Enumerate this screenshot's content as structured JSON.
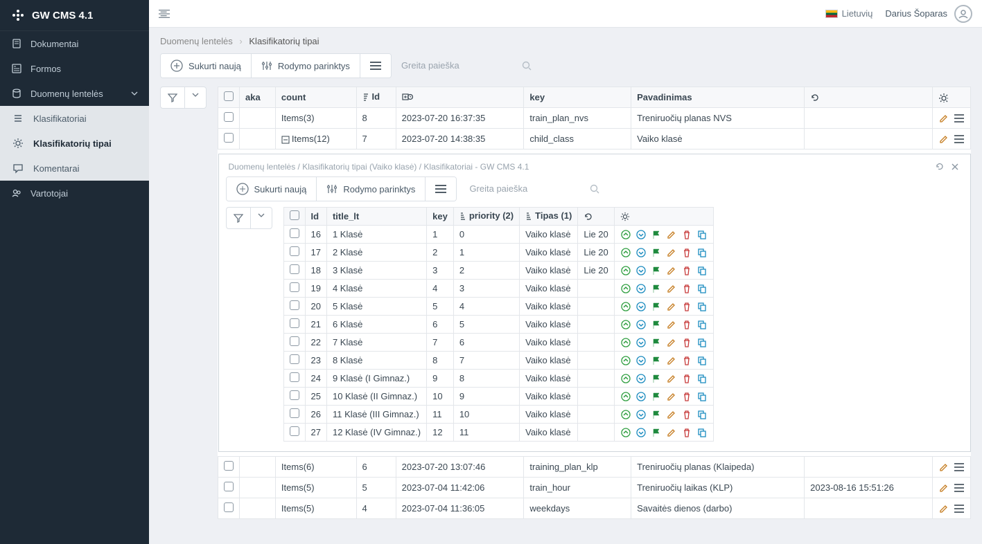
{
  "brand": "GW CMS 4.1",
  "topbar": {
    "language": "Lietuvių",
    "user": "Darius Šoparas"
  },
  "nav": {
    "items": [
      {
        "label": "Dokumentai",
        "icon": "doc"
      },
      {
        "label": "Formos",
        "icon": "form"
      },
      {
        "label": "Duomenų lentelės",
        "icon": "db",
        "expandable": true,
        "expanded": true,
        "children": [
          {
            "label": "Klasifikatoriai",
            "icon": "list"
          },
          {
            "label": "Klasifikatorių tipai",
            "icon": "gear",
            "active": true
          },
          {
            "label": "Komentarai",
            "icon": "chat"
          }
        ]
      },
      {
        "label": "Vartotojai",
        "icon": "users"
      }
    ]
  },
  "breadcrumb": {
    "parent": "Duomenų lentelės",
    "current": "Klasifikatorių tipai"
  },
  "toolbar": {
    "create": "Sukurti naują",
    "display": "Rodymo parinktys",
    "search_ph": "Greita paieška"
  },
  "grid": {
    "headers": {
      "aka": "aka",
      "count": "count",
      "id": "Id",
      "created": "",
      "key": "key",
      "name": "Pavadinimas",
      "updated": ""
    },
    "rows": [
      {
        "count": "Items(3)",
        "id": "8",
        "created": "2023-07-20 16:37:35",
        "key": "train_plan_nvs",
        "name": "Treniruočių planas NVS",
        "updated": "",
        "expandable": false
      },
      {
        "count": "Items(12)",
        "id": "7",
        "created": "2023-07-20 14:38:35",
        "key": "child_class",
        "name": "Vaiko klasė",
        "updated": "",
        "expandable": true,
        "expanded": true
      },
      {
        "count": "Items(6)",
        "id": "6",
        "created": "2023-07-20 13:07:46",
        "key": "training_plan_klp",
        "name": "Treniruočių planas (Klaipeda)",
        "updated": ""
      },
      {
        "count": "Items(5)",
        "id": "5",
        "created": "2023-07-04 11:42:06",
        "key": "train_hour",
        "name": "Treniruočių laikas (KLP)",
        "updated": "2023-08-16 15:51:26"
      },
      {
        "count": "Items(5)",
        "id": "4",
        "created": "2023-07-04 11:36:05",
        "key": "weekdays",
        "name": "Savaitės dienos (darbo)",
        "updated": ""
      }
    ]
  },
  "nested": {
    "title": "Duomenų lentelės / Klasifikatorių tipai (Vaiko klasė) / Klasifikatoriai - GW CMS 4.1",
    "toolbar": {
      "create": "Sukurti naują",
      "display": "Rodymo parinktys",
      "search_ph": "Greita paieška"
    },
    "headers": {
      "id": "Id",
      "title_lt": "title_lt",
      "key": "key",
      "priority": "priority (2)",
      "tipas": "Tipas (1)",
      "updated": ""
    },
    "rows": [
      {
        "id": "16",
        "title_lt": "1 Klasė",
        "key": "1",
        "priority": "0",
        "tipas": "Vaiko klasė",
        "updated": "Lie 20"
      },
      {
        "id": "17",
        "title_lt": "2 Klasė",
        "key": "2",
        "priority": "1",
        "tipas": "Vaiko klasė",
        "updated": "Lie 20"
      },
      {
        "id": "18",
        "title_lt": "3 Klasė",
        "key": "3",
        "priority": "2",
        "tipas": "Vaiko klasė",
        "updated": "Lie 20"
      },
      {
        "id": "19",
        "title_lt": "4 Klasė",
        "key": "4",
        "priority": "3",
        "tipas": "Vaiko klasė",
        "updated": ""
      },
      {
        "id": "20",
        "title_lt": "5 Klasė",
        "key": "5",
        "priority": "4",
        "tipas": "Vaiko klasė",
        "updated": ""
      },
      {
        "id": "21",
        "title_lt": "6 Klasė",
        "key": "6",
        "priority": "5",
        "tipas": "Vaiko klasė",
        "updated": ""
      },
      {
        "id": "22",
        "title_lt": "7 Klasė",
        "key": "7",
        "priority": "6",
        "tipas": "Vaiko klasė",
        "updated": ""
      },
      {
        "id": "23",
        "title_lt": "8 Klasė",
        "key": "8",
        "priority": "7",
        "tipas": "Vaiko klasė",
        "updated": ""
      },
      {
        "id": "24",
        "title_lt": "9 Klasė (I Gimnaz.)",
        "key": "9",
        "priority": "8",
        "tipas": "Vaiko klasė",
        "updated": ""
      },
      {
        "id": "25",
        "title_lt": "10 Klasė (II Gimnaz.)",
        "key": "10",
        "priority": "9",
        "tipas": "Vaiko klasė",
        "updated": ""
      },
      {
        "id": "26",
        "title_lt": "11 Klasė (III Gimnaz.)",
        "key": "11",
        "priority": "10",
        "tipas": "Vaiko klasė",
        "updated": ""
      },
      {
        "id": "27",
        "title_lt": "12 Klasė (IV Gimnaz.)",
        "key": "12",
        "priority": "11",
        "tipas": "Vaiko klasė",
        "updated": ""
      }
    ]
  }
}
